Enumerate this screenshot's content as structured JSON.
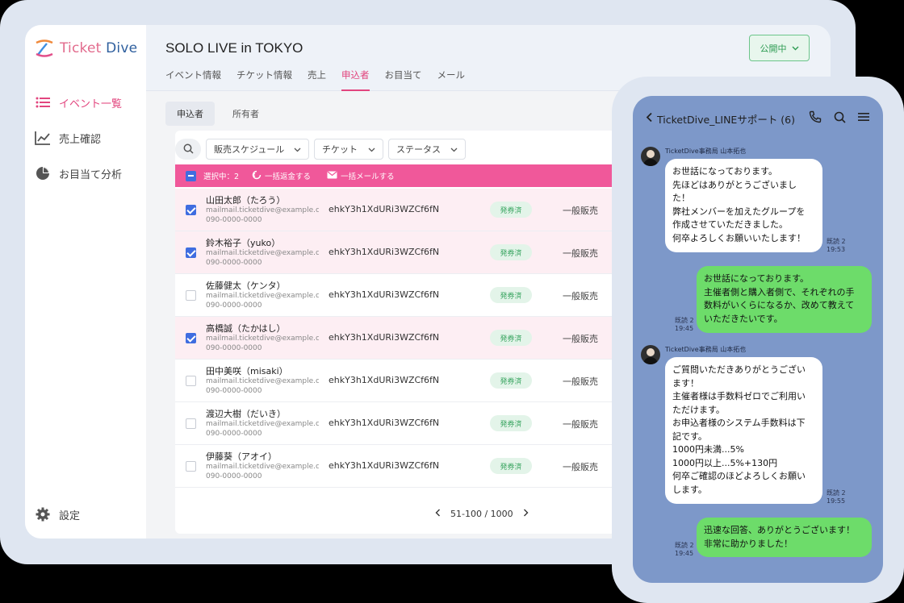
{
  "logo": {
    "ticket": "Ticket",
    "dive": " Dive"
  },
  "sidebar": {
    "items": [
      {
        "label": "イベント一覧",
        "icon": "list-icon"
      },
      {
        "label": "売上確認",
        "icon": "chart-icon"
      },
      {
        "label": "お目当て分析",
        "icon": "pie-icon"
      }
    ],
    "settings_label": "設定"
  },
  "header": {
    "title": "SOLO LIVE in TOKYO",
    "publish_label": "公開中",
    "tabs": [
      "イベント情報",
      "チケット情報",
      "売上",
      "申込者",
      "お目当て",
      "メール"
    ]
  },
  "subtabs": [
    "申込者",
    "所有者"
  ],
  "filters": {
    "schedule": "販売スケジュール",
    "ticket": "チケット",
    "status": "ステータス"
  },
  "bulkbar": {
    "selected": "選択中：2",
    "refund": "一括返金する",
    "mail": "一括メールする"
  },
  "rows": [
    {
      "name": "山田太郎（たろう）",
      "email": "mailmail.ticketdive@example.com",
      "phone": "090-0000-0000",
      "code": "ehkY3h1XdURi3WZCf6fN",
      "status": "発券済",
      "type": "一般販売"
    },
    {
      "name": "鈴木裕子（yuko）",
      "email": "mailmail.ticketdive@example.com",
      "phone": "090-0000-0000",
      "code": "ehkY3h1XdURi3WZCf6fN",
      "status": "発券済",
      "type": "一般販売"
    },
    {
      "name": "佐藤健太（ケンタ）",
      "email": "mailmail.ticketdive@example.com",
      "phone": "090-0000-0000",
      "code": "ehkY3h1XdURi3WZCf6fN",
      "status": "発券済",
      "type": "一般販売"
    },
    {
      "name": "高橋誠（たかはし）",
      "email": "mailmail.ticketdive@example.com",
      "phone": "090-0000-0000",
      "code": "ehkY3h1XdURi3WZCf6fN",
      "status": "発券済",
      "type": "一般販売"
    },
    {
      "name": "田中美咲（misaki）",
      "email": "mailmail.ticketdive@example.com",
      "phone": "090-0000-0000",
      "code": "ehkY3h1XdURi3WZCf6fN",
      "status": "発券済",
      "type": "一般販売"
    },
    {
      "name": "渡辺大樹（だいき）",
      "email": "mailmail.ticketdive@example.com",
      "phone": "090-0000-0000",
      "code": "ehkY3h1XdURi3WZCf6fN",
      "status": "発券済",
      "type": "一般販売"
    },
    {
      "name": "伊藤葵（アオイ）",
      "email": "mailmail.ticketdive@example.com",
      "phone": "090-0000-0000",
      "code": "ehkY3h1XdURi3WZCf6fN",
      "status": "発券済",
      "type": "一般販売"
    }
  ],
  "pager": {
    "range": "51-100 / 1000"
  },
  "chat": {
    "title": "TicketDive_LINEサポート (6)",
    "sender": "TicketDive事務局 山本拓也",
    "messages": [
      {
        "text": "お世話になっております。\n先ほどはありがとうございまし\nた！\n弊社メンバーを加えたグループを\n作成させていただきました。\n何卒よろしくお願いいたします！",
        "read": "既読 2",
        "time": "19:53"
      },
      {
        "text": "お世話になっております。\n主催者側と購入者側で、それぞれの手\n数料がいくらになるか、改めて教えて\nいただきたいです。",
        "read": "既読 2",
        "time": "19:45"
      },
      {
        "text": "ご質問いただきありがとうござい\nます！\n主催者様は手数料ゼロでご利用い\nただけます。\nお申込者様のシステム手数料は下\n記です。\n1000円未満...5%\n1000円以上...5%+130円\n何卒ご確認のほどよろしくお願い\nします。",
        "read": "既読 2",
        "time": "19:55"
      },
      {
        "text": "迅速な回答、ありがとうございます！\n非常に助かりました！",
        "read": "既読 2",
        "time": "19:45"
      }
    ]
  },
  "colors": {
    "accent": "#e2457e",
    "bulkbar": "#f0589a",
    "check": "#3f6de0",
    "line_green": "#6ddc6a"
  }
}
